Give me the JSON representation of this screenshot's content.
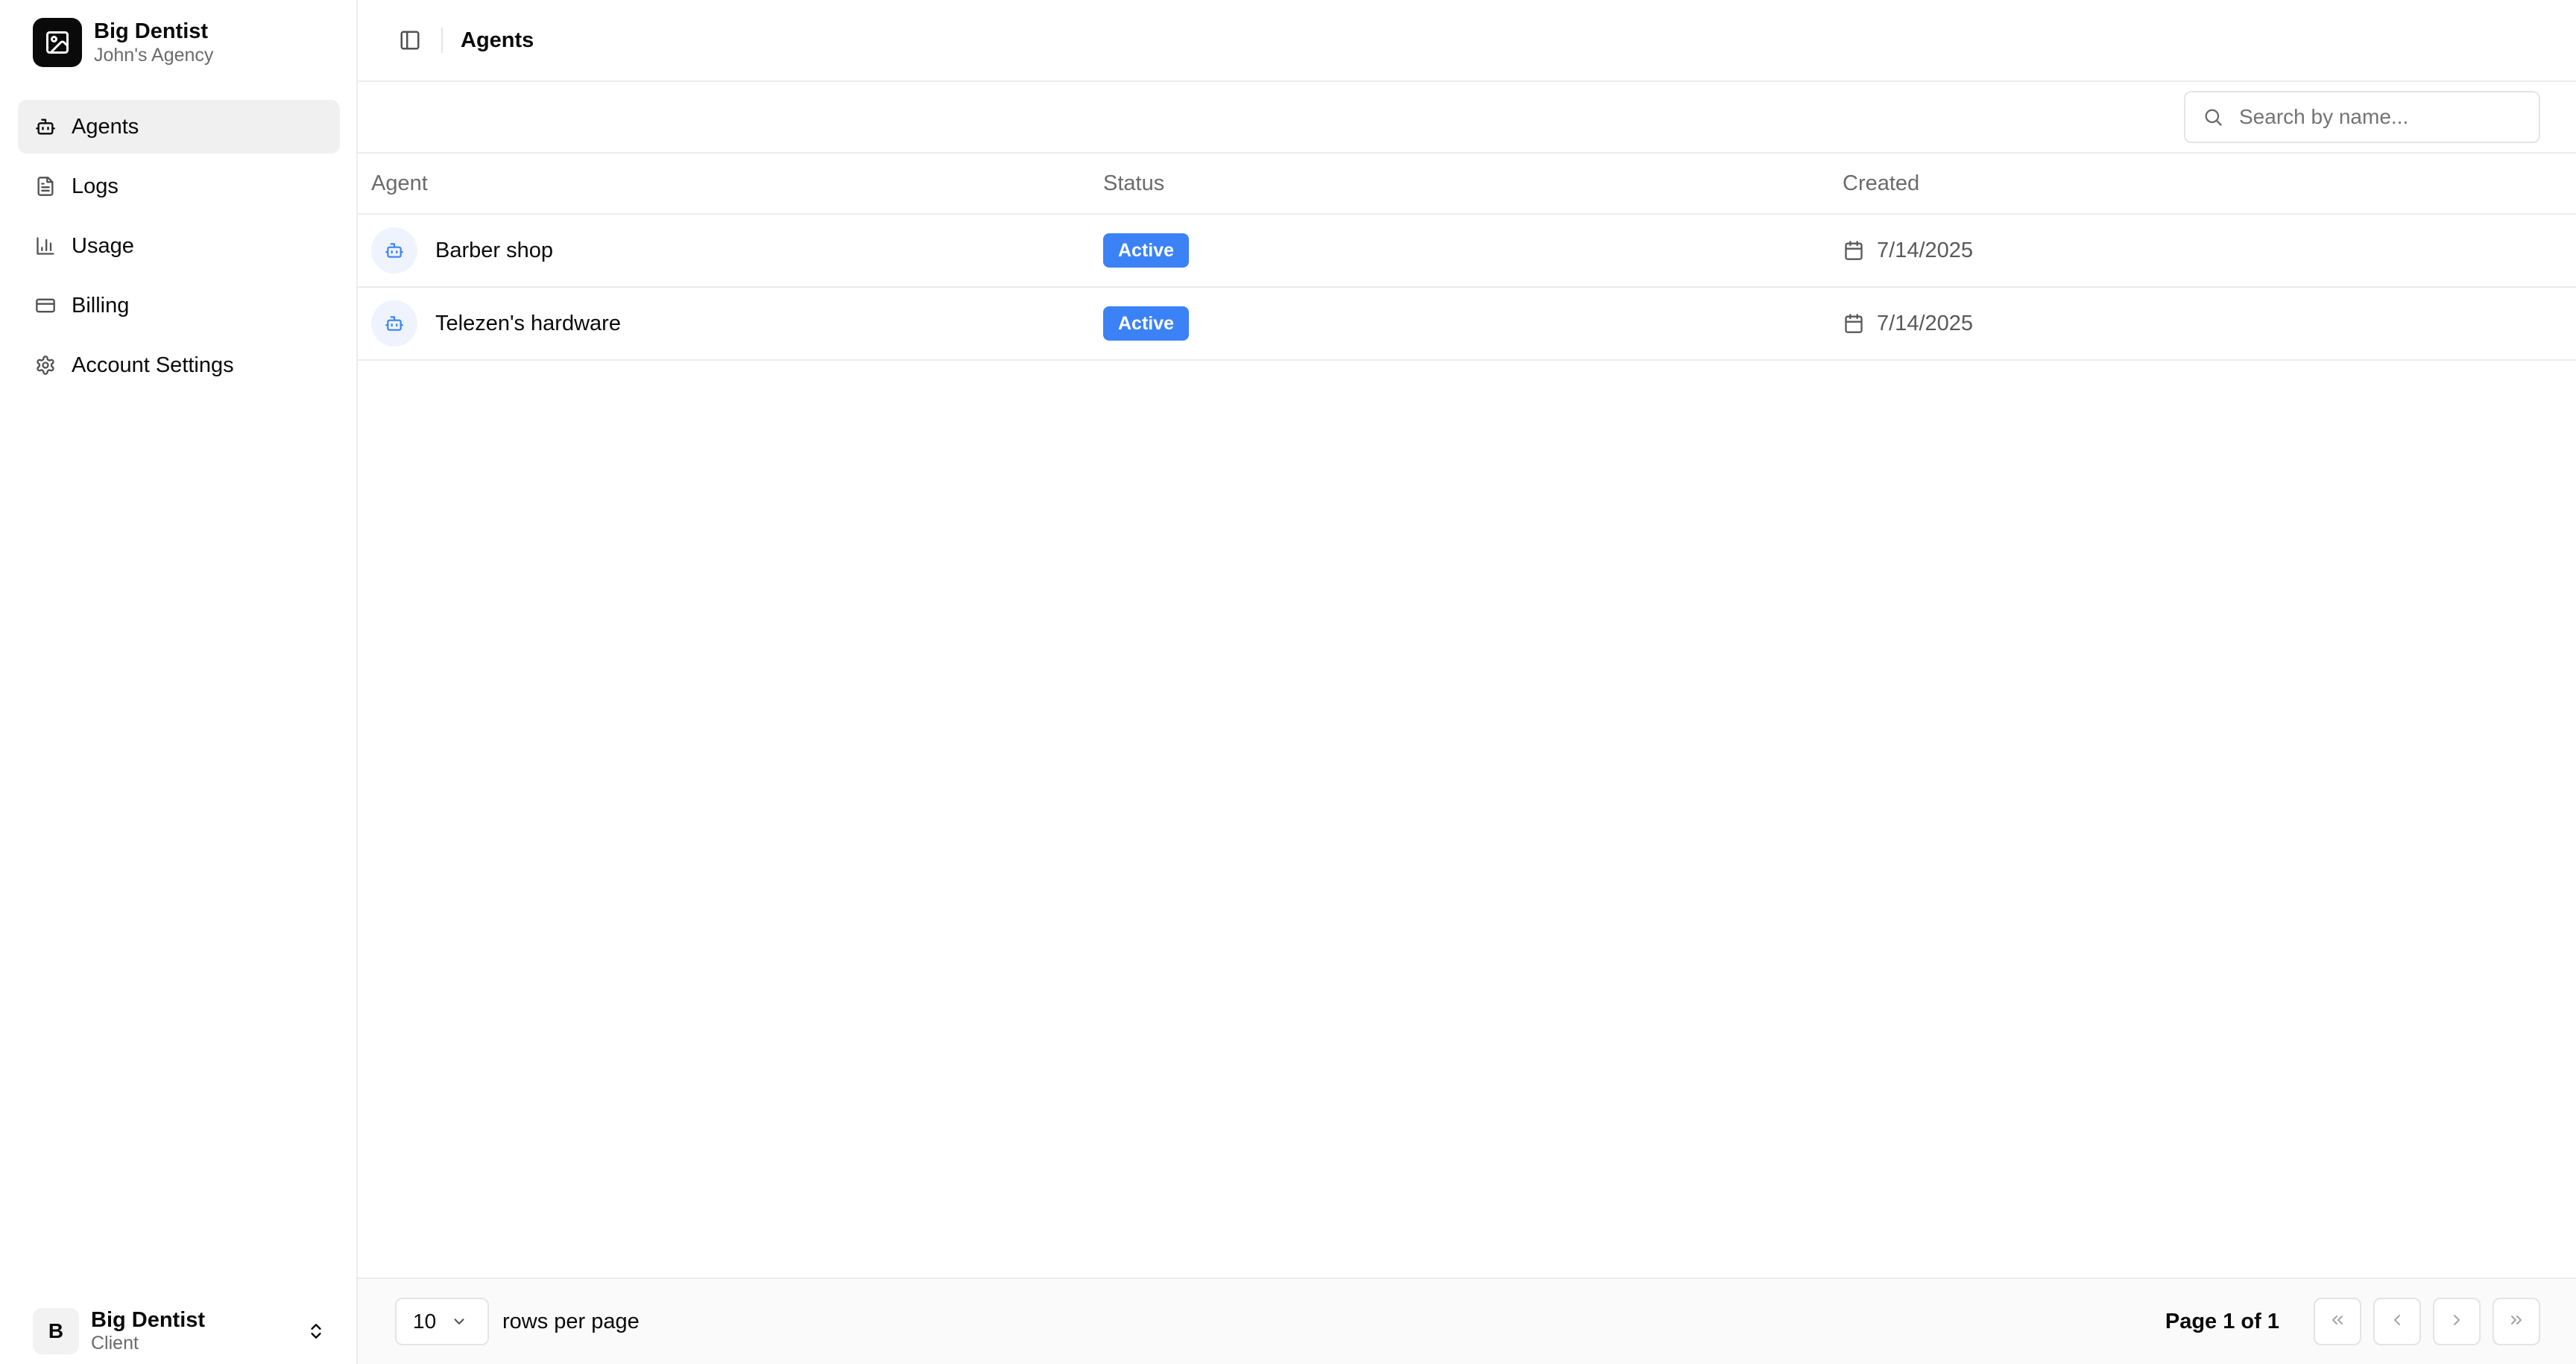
{
  "workspace": {
    "name": "Big Dentist",
    "agency": "John's Agency"
  },
  "sidebar": {
    "items": [
      {
        "label": "Agents",
        "icon": "bot-icon",
        "active": true
      },
      {
        "label": "Logs",
        "icon": "file-text-icon",
        "active": false
      },
      {
        "label": "Usage",
        "icon": "bar-chart-icon",
        "active": false
      },
      {
        "label": "Billing",
        "icon": "credit-card-icon",
        "active": false
      },
      {
        "label": "Account Settings",
        "icon": "gear-icon",
        "active": false
      }
    ]
  },
  "user": {
    "initial": "B",
    "name": "Big Dentist",
    "role": "Client"
  },
  "header": {
    "title": "Agents"
  },
  "search": {
    "placeholder": "Search by name...",
    "value": ""
  },
  "table": {
    "columns": [
      "Agent",
      "Status",
      "Created"
    ],
    "rows": [
      {
        "agent": "Barber shop",
        "status": "Active",
        "created": "7/14/2025"
      },
      {
        "agent": "Telezen's hardware",
        "status": "Active",
        "created": "7/14/2025"
      }
    ]
  },
  "pagination": {
    "rows_per_page": "10",
    "rows_label": "rows per page",
    "page_info": "Page 1 of 1"
  },
  "colors": {
    "accent": "#3b82f6",
    "agent_icon_bg": "#eef3fe",
    "sidebar_active_bg": "#f0f0f0"
  }
}
